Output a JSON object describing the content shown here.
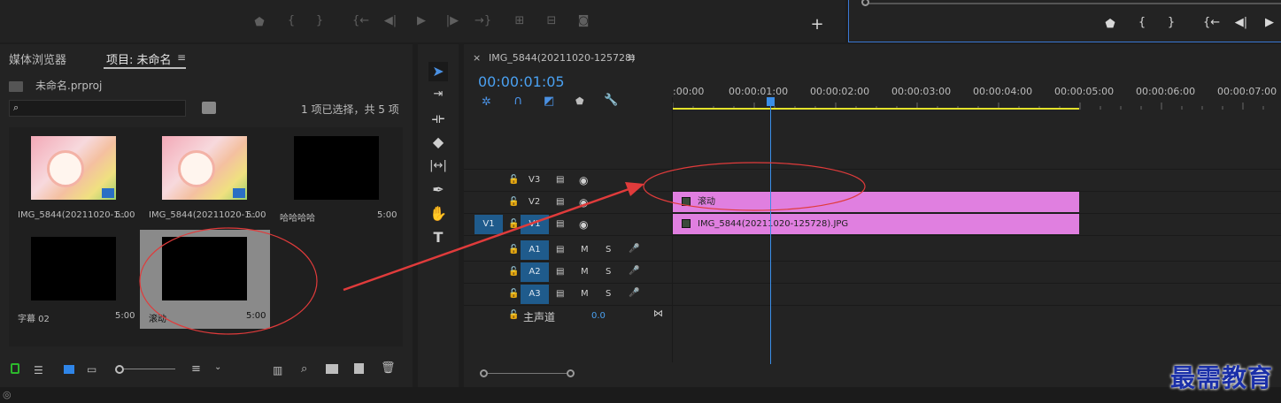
{
  "project_panel": {
    "tab_media_browser": "媒体浏览器",
    "tab_project": "项目: 未命名",
    "project_file": "未命名.prproj",
    "search_placeholder": "",
    "selection_status": "1 项已选择，共 5 项",
    "items": [
      {
        "name": "IMG_5844(20211020-1...",
        "duration": "5:00"
      },
      {
        "name": "IMG_5844(20211020-1...",
        "duration": "5:00"
      },
      {
        "name": "哈哈哈哈",
        "duration": "5:00"
      },
      {
        "name": "字幕 02",
        "duration": "5:00"
      },
      {
        "name": "滚动",
        "duration": "5:00"
      }
    ]
  },
  "timeline": {
    "sequence_name": "IMG_5844(20211020-125728)",
    "timecode": "00:00:01:05",
    "ruler": [
      ":00:00",
      "00:00:01:00",
      "00:00:02:00",
      "00:00:03:00",
      "00:00:04:00",
      "00:00:05:00",
      "00:00:06:00",
      "00:00:07:00"
    ],
    "video_tracks": [
      "V3",
      "V2",
      "V1"
    ],
    "source_patch": "V1",
    "audio_tracks": [
      "A1",
      "A2",
      "A3"
    ],
    "mute_label": "M",
    "solo_label": "S",
    "master_label": "主声道",
    "master_value": "0.0",
    "clip_v2": "滚动",
    "clip_v1": "IMG_5844(20211020-125728).JPG",
    "add_button": "+"
  },
  "watermark": "最需教育",
  "colors": {
    "accent": "#3a78d4",
    "clip": "#e07fe0",
    "annotation": "#e03b3b",
    "work_area": "#e4e22a"
  }
}
